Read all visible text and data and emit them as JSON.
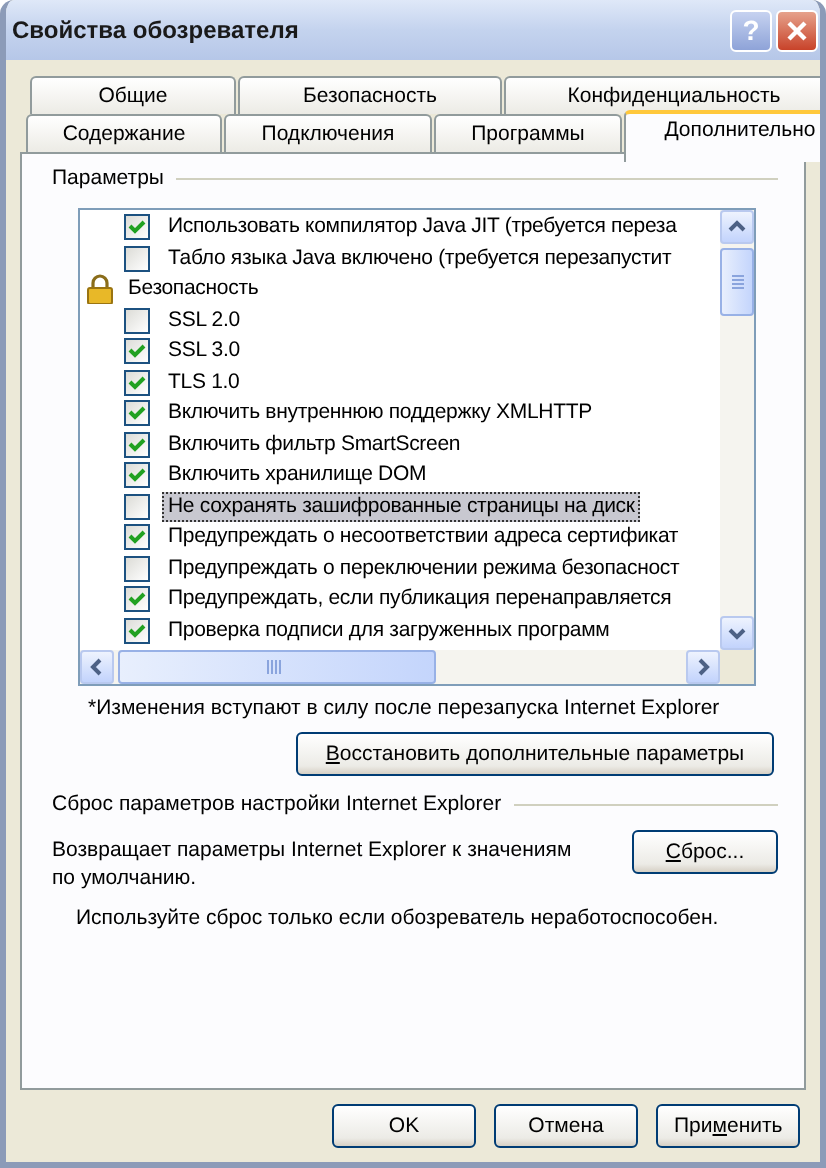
{
  "window": {
    "title": "Свойства обозревателя",
    "help": "?"
  },
  "tabs": [
    [
      {
        "label": "Общие",
        "selected": false
      },
      {
        "label": "Безопасность",
        "selected": false
      },
      {
        "label": "Конфиденциальность",
        "selected": false
      }
    ],
    [
      {
        "label": "Содержание",
        "selected": false
      },
      {
        "label": "Подключения",
        "selected": false
      },
      {
        "label": "Программы",
        "selected": false
      },
      {
        "label": "Дополнительно",
        "selected": true
      }
    ]
  ],
  "settings": {
    "title": "Параметры",
    "items": [
      {
        "kind": "checkbox",
        "label": "Использовать компилятор Java JIT (требуется переза",
        "checked": true,
        "selected": false
      },
      {
        "kind": "checkbox",
        "label": "Табло языка Java включено (требуется перезапустит",
        "checked": false,
        "selected": false
      },
      {
        "kind": "group",
        "label": "Безопасность"
      },
      {
        "kind": "checkbox",
        "label": "SSL 2.0",
        "checked": false,
        "selected": false
      },
      {
        "kind": "checkbox",
        "label": "SSL 3.0",
        "checked": true,
        "selected": false
      },
      {
        "kind": "checkbox",
        "label": "TLS 1.0",
        "checked": true,
        "selected": false
      },
      {
        "kind": "checkbox",
        "label": "Включить внутреннюю поддержку XMLHTTP",
        "checked": true,
        "selected": false
      },
      {
        "kind": "checkbox",
        "label": "Включить фильтр SmartScreen",
        "checked": true,
        "selected": false
      },
      {
        "kind": "checkbox",
        "label": "Включить хранилище DOM",
        "checked": true,
        "selected": false
      },
      {
        "kind": "checkbox",
        "label": "Не сохранять зашифрованные страницы на диск",
        "checked": false,
        "selected": true
      },
      {
        "kind": "checkbox",
        "label": "Предупреждать о несоответствии адреса сертификат",
        "checked": true,
        "selected": false
      },
      {
        "kind": "checkbox",
        "label": "Предупреждать о переключении режима безопасност",
        "checked": false,
        "selected": false
      },
      {
        "kind": "checkbox",
        "label": "Предупреждать, если публикация перенаправляется",
        "checked": true,
        "selected": false
      },
      {
        "kind": "checkbox",
        "label": "Проверка подписи для загруженных программ",
        "checked": true,
        "selected": false
      }
    ],
    "note": "*Изменения вступают в силу после перезапуска Internet Explorer",
    "restore_button": {
      "key": "В",
      "after": "осстановить дополнительные параметры"
    }
  },
  "reset": {
    "title": "Сброс параметров настройки Internet Explorer",
    "description": "Возвращает параметры Internet Explorer к значениям по умолчанию.",
    "button": {
      "key": "С",
      "after": "брос..."
    },
    "warning": "Используйте сброс только если обозреватель неработоспособен."
  },
  "buttons": [
    {
      "label": "OK"
    },
    {
      "label": "Отмена"
    },
    {
      "before": "При",
      "key": "м",
      "after": "енить"
    }
  ]
}
